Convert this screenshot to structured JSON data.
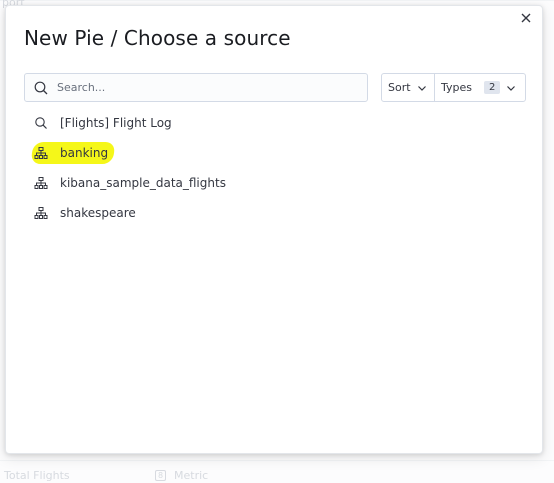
{
  "modal": {
    "title": "New Pie / Choose a source",
    "close_label": "×"
  },
  "search": {
    "placeholder": "Search...",
    "value": ""
  },
  "filters": {
    "sort_label": "Sort",
    "types_label": "Types",
    "types_count": "2"
  },
  "sources": [
    {
      "label": "[Flights] Flight Log",
      "icon": "search-icon",
      "highlighted": false
    },
    {
      "label": "banking",
      "icon": "index-pattern-icon",
      "highlighted": true
    },
    {
      "label": "kibana_sample_data_flights",
      "icon": "index-pattern-icon",
      "highlighted": false
    },
    {
      "label": "shakespeare",
      "icon": "index-pattern-icon",
      "highlighted": false
    }
  ],
  "background": {
    "bottom_left_text": "Total Flights",
    "metric_label": "Metric",
    "metric_icon_char": "8",
    "top_left_text": "port"
  },
  "colors": {
    "highlight": "#f4f70d",
    "border": "#d3dae6",
    "text": "#343741"
  }
}
